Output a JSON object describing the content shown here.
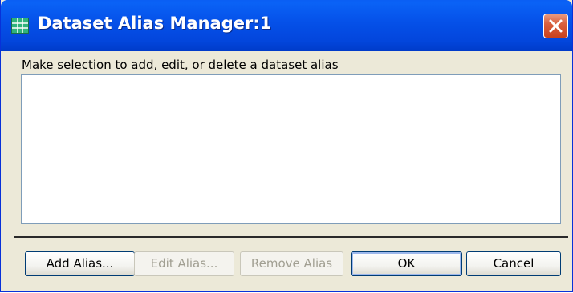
{
  "window": {
    "title": "Dataset Alias Manager:1",
    "icon": "dataset-grid-icon",
    "close_icon": "close-icon"
  },
  "main": {
    "prompt": "Make selection to add, edit, or delete a dataset alias",
    "alias_list": []
  },
  "buttons": {
    "add": "Add Alias...",
    "edit": "Edit Alias...",
    "remove": "Remove Alias",
    "ok": "OK",
    "cancel": "Cancel"
  },
  "colors": {
    "titlebar": "#0550e8",
    "close_button": "#d9603e",
    "window_background": "#ece9d8",
    "disabled_text": "#a19f92"
  }
}
